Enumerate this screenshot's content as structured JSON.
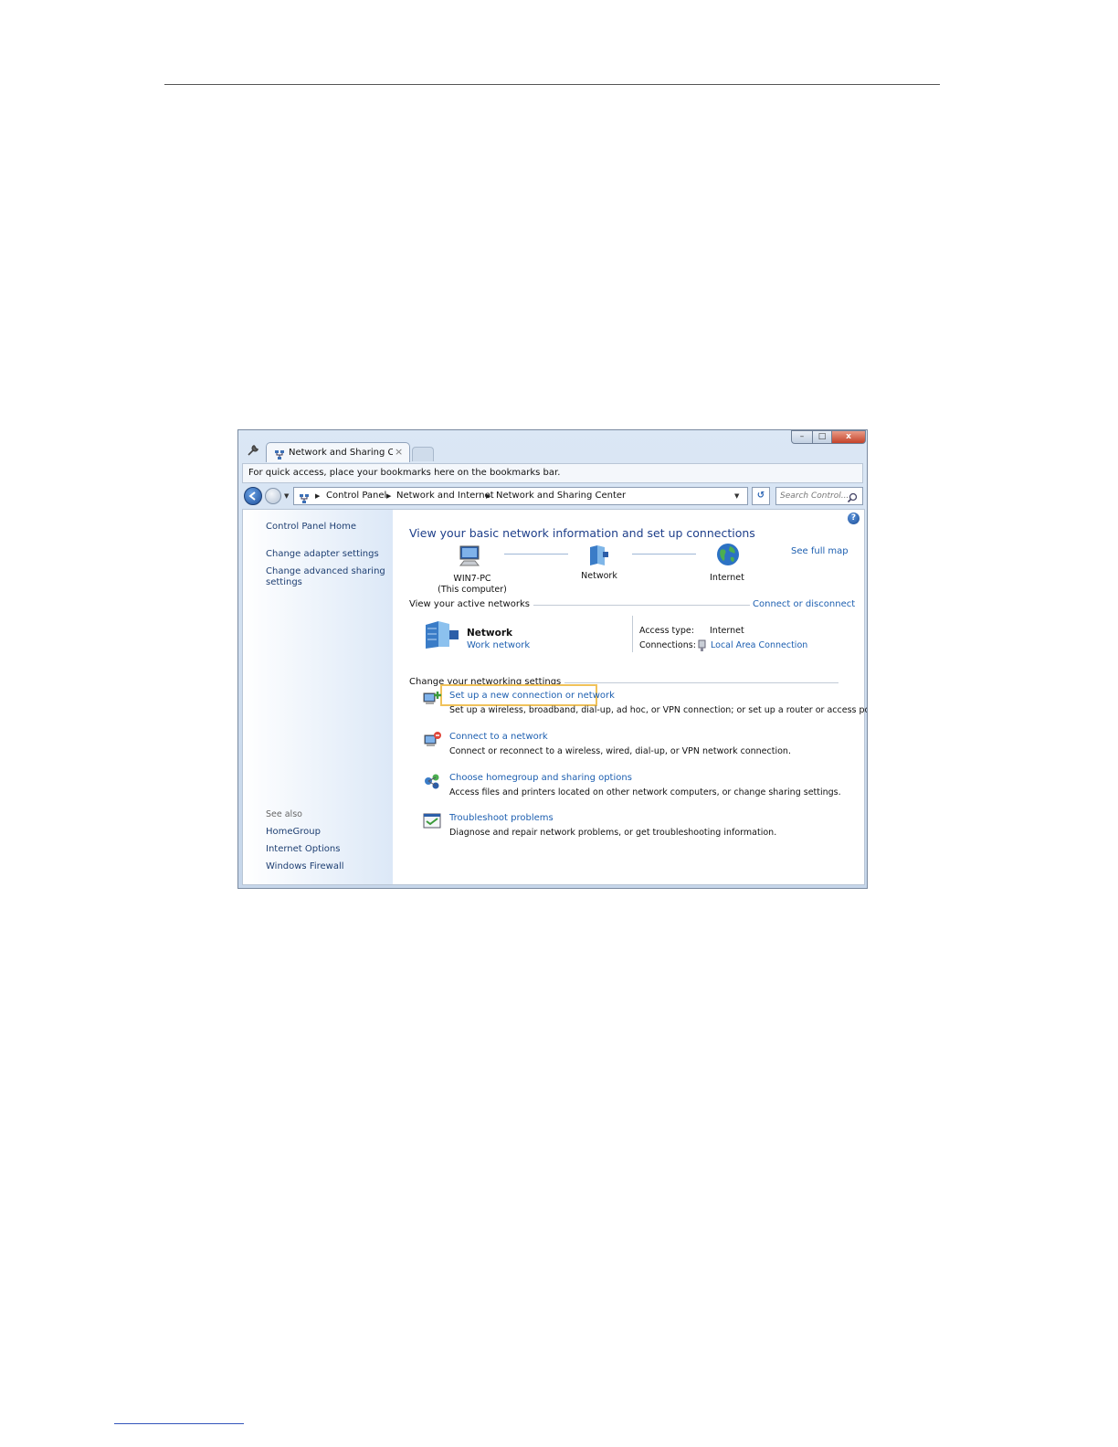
{
  "tab": {
    "title": "Network and Sharing Cent",
    "close": "×"
  },
  "window_controls": {
    "minimize": "–",
    "maximize": "□",
    "close": "x"
  },
  "bookmarks_bar": {
    "text": "For quick access, place your bookmarks here on the bookmarks bar."
  },
  "breadcrumbs": [
    "Control Panel",
    "Network and Internet",
    "Network and Sharing Center"
  ],
  "search": {
    "placeholder": "Search Control..."
  },
  "sidebar": {
    "home": "Control Panel Home",
    "links": [
      "Change adapter settings",
      "Change advanced sharing",
      "settings"
    ],
    "see_also_title": "See also",
    "see_also": [
      "HomeGroup",
      "Internet Options",
      "Windows Firewall"
    ]
  },
  "main": {
    "help": "?",
    "title": "View your basic network information and set up connections",
    "see_full_map": "See full map",
    "map": {
      "computer": {
        "name": "WIN7-PC",
        "sub": "(This computer)"
      },
      "network": "Network",
      "internet": "Internet"
    },
    "active_networks": {
      "header": "View your active networks",
      "connect_link": "Connect or disconnect",
      "name": "Network",
      "type": "Work network",
      "access_type_label": "Access type:",
      "access_type_value": "Internet",
      "connections_label": "Connections:",
      "connections_value": "Local Area Connection"
    },
    "change_settings": {
      "header": "Change your networking settings",
      "tasks": [
        {
          "link": "Set up a new connection or network",
          "desc": "Set up a wireless, broadband, dial-up, ad hoc, or VPN connection; or set up a router or access point."
        },
        {
          "link": "Connect to a network",
          "desc": "Connect or reconnect to a wireless, wired, dial-up, or VPN network connection."
        },
        {
          "link": "Choose homegroup and sharing options",
          "desc": "Access files and printers located on other network computers, or change sharing settings."
        },
        {
          "link": "Troubleshoot problems",
          "desc": "Diagnose and repair network problems, or get troubleshooting information."
        }
      ]
    }
  },
  "colors": {
    "link": "#1d5fb0",
    "title": "#1e3f8a",
    "highlight": "#f0c25a"
  }
}
